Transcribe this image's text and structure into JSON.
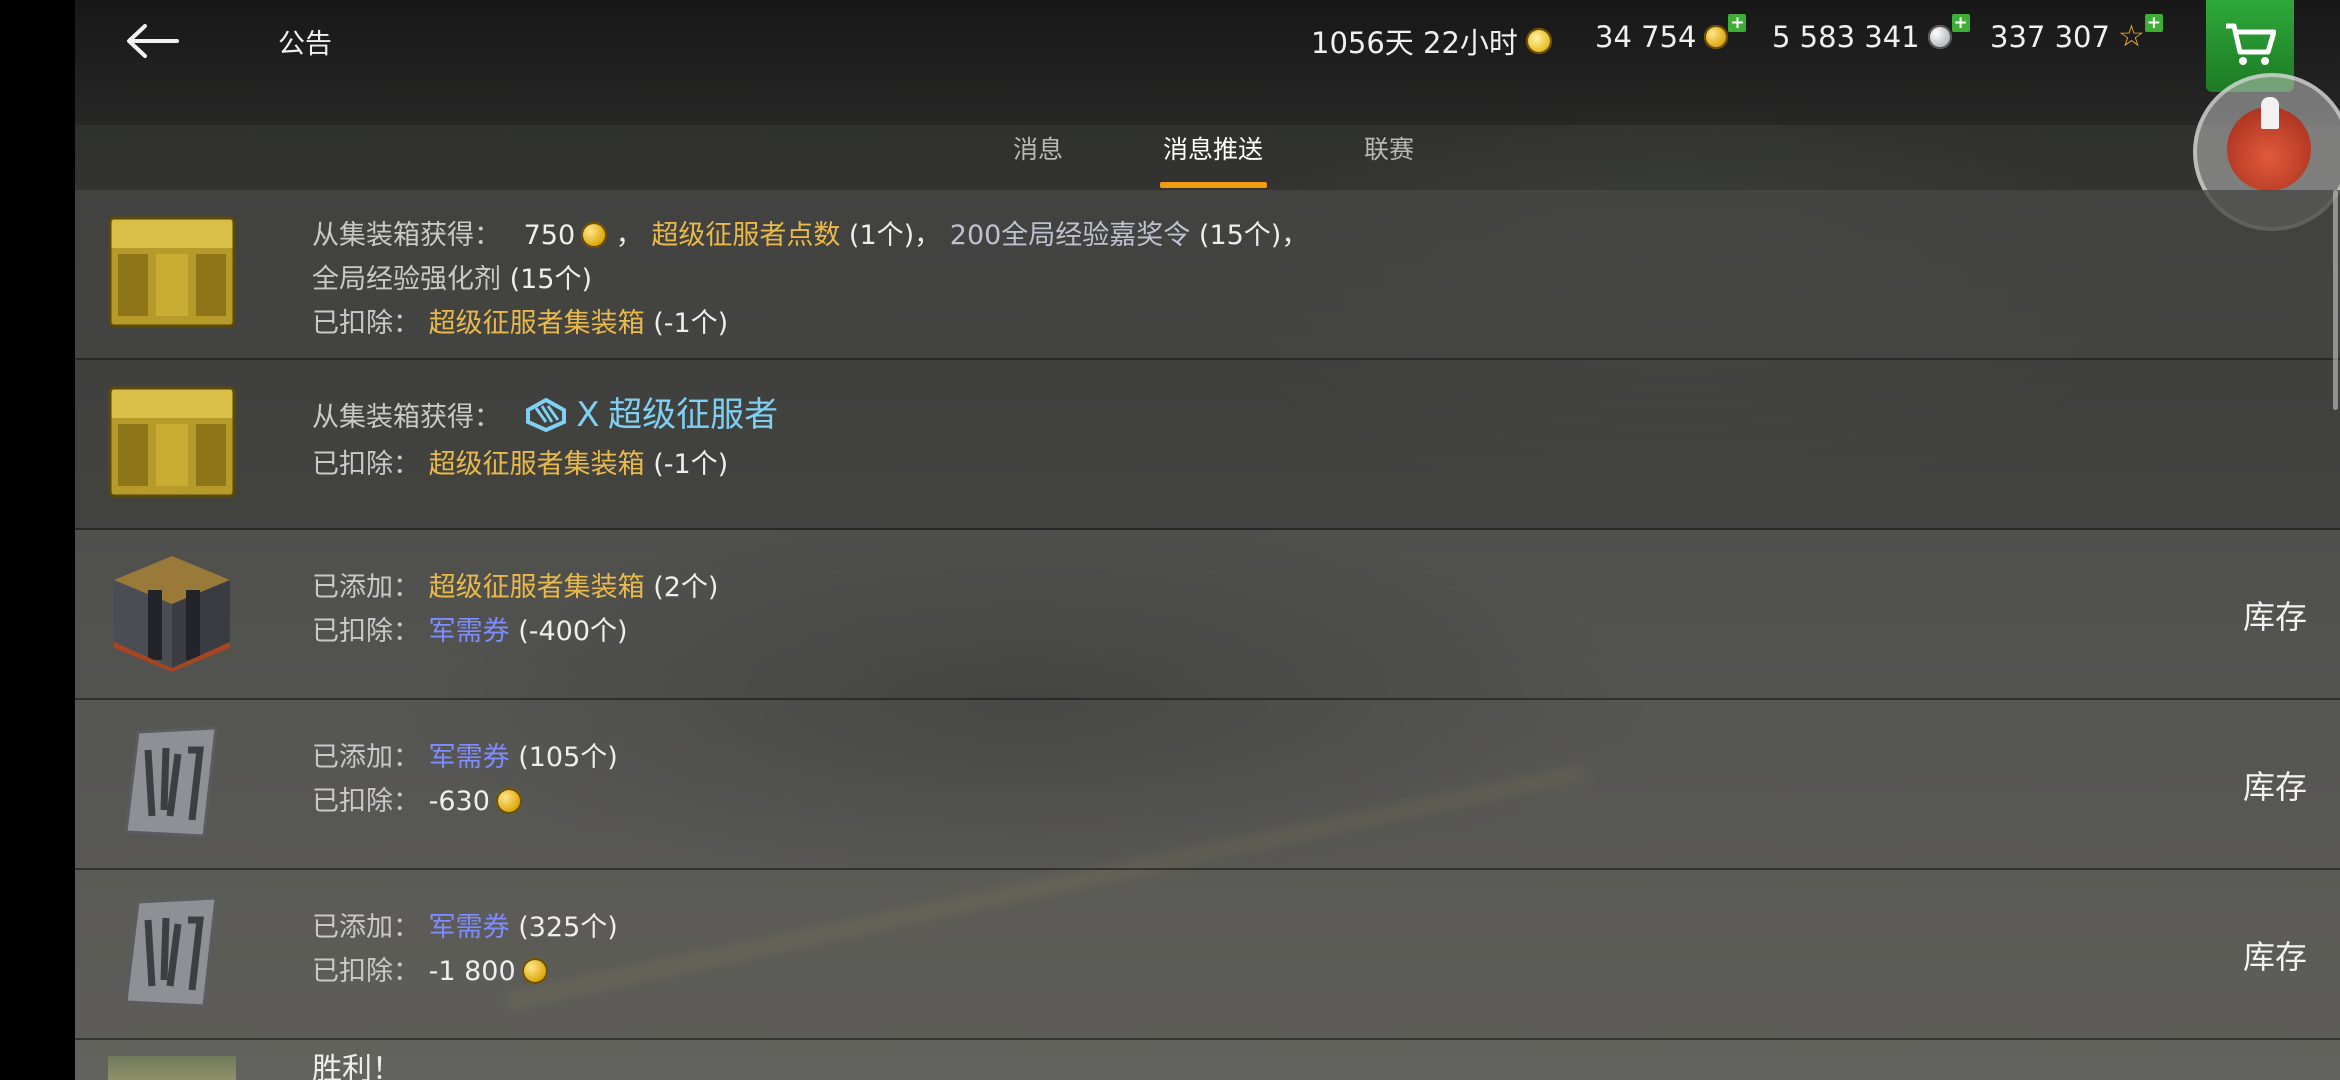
{
  "header": {
    "title": "公告",
    "stats": {
      "premium_time": "1056天 22小时",
      "gold": "34 754",
      "credits": "5 583 341",
      "free_xp": "337 307"
    }
  },
  "tabs": [
    {
      "label": "消息"
    },
    {
      "label": "消息推送"
    },
    {
      "label": "联赛"
    }
  ],
  "messages": [
    {
      "l1_label": "从集装箱获得：",
      "l1_gold": "750",
      "l1_sep1": "，",
      "l1_item1": "超级征服者点数",
      "l1_item1_qty": "(1个)",
      "l1_sep2": "，",
      "l1_item2": "200全局经验嘉奖令",
      "l1_item2_qty": "(15个)",
      "l1_sep3": "，",
      "l2_item": "全局经验强化剂",
      "l2_qty": "(15个)",
      "l3_label": "已扣除：",
      "l3_item": "超级征服者集装箱",
      "l3_qty": "(-1个)"
    },
    {
      "l1_label": "从集装箱获得：",
      "tier": "X",
      "tank": "超级征服者",
      "l2_label": "已扣除：",
      "l2_item": "超级征服者集装箱",
      "l2_qty": "(-1个)"
    },
    {
      "l1_label": "已添加：",
      "l1_item": "超级征服者集装箱",
      "l1_qty": "(2个)",
      "l2_label": "已扣除：",
      "l2_item": "军需券",
      "l2_qty": "(-400个)",
      "action": "库存"
    },
    {
      "l1_label": "已添加：",
      "l1_item": "军需券",
      "l1_qty": "(105个)",
      "l2_label": "已扣除：",
      "l2_value": "-630",
      "action": "库存"
    },
    {
      "l1_label": "已添加：",
      "l1_item": "军需券",
      "l1_qty": "(325个)",
      "l2_label": "已扣除：",
      "l2_value": "-1 800",
      "action": "库存"
    },
    {
      "title": "胜利！"
    }
  ]
}
